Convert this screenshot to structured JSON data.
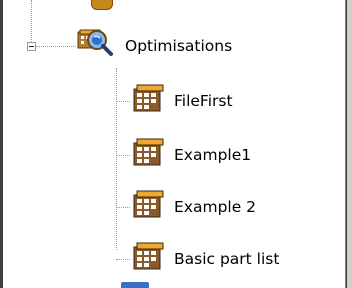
{
  "tree": {
    "parent": {
      "label": "Optimisations",
      "icon": "optimisations-magnifier-icon",
      "expanded": true
    },
    "children": [
      {
        "label": "FileFirst",
        "icon": "spreadsheet-report-icon"
      },
      {
        "label": "Example1",
        "icon": "spreadsheet-report-icon"
      },
      {
        "label": "Example 2",
        "icon": "spreadsheet-report-icon"
      },
      {
        "label": "Basic part list",
        "icon": "spreadsheet-report-icon"
      }
    ]
  },
  "colors": {
    "connector": "#9a9a9a",
    "icon_brown": "#8a5a2b",
    "icon_orange": "#f0a830",
    "magnifier_blue": "#2f6fd0"
  }
}
